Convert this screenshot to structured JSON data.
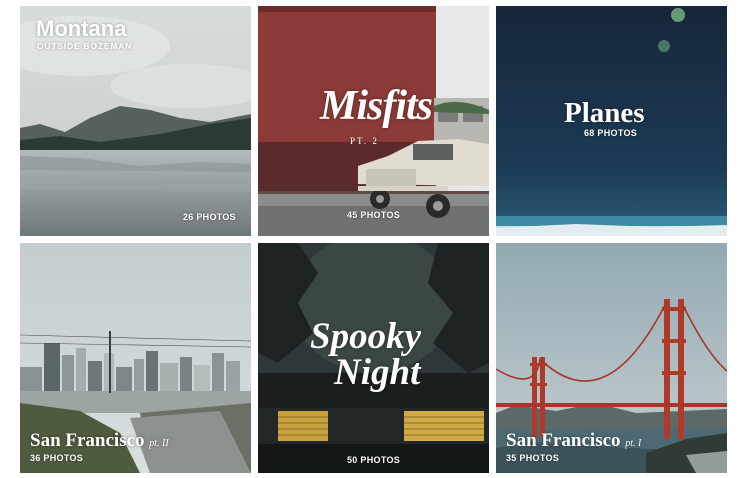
{
  "albums": [
    {
      "title": "Montana",
      "subtitle": "OUTSIDE BOZEMAN",
      "count": "26 PHOTOS"
    },
    {
      "title": "Misfits",
      "subtitle": "PT. 2",
      "count": "45 PHOTOS"
    },
    {
      "title": "Planes",
      "count": "68 PHOTOS"
    },
    {
      "title": "San Francisco",
      "subtitle": "pt. II",
      "count": "36 PHOTOS"
    },
    {
      "title_line1": "Spooky",
      "title_line2": "Night",
      "count": "50 PHOTOS"
    },
    {
      "title": "San Francisco",
      "subtitle": "pt. I",
      "count": "35 PHOTOS"
    }
  ],
  "colors": {
    "text": "#ffffff",
    "page_background": "#ffffff"
  },
  "icons": []
}
